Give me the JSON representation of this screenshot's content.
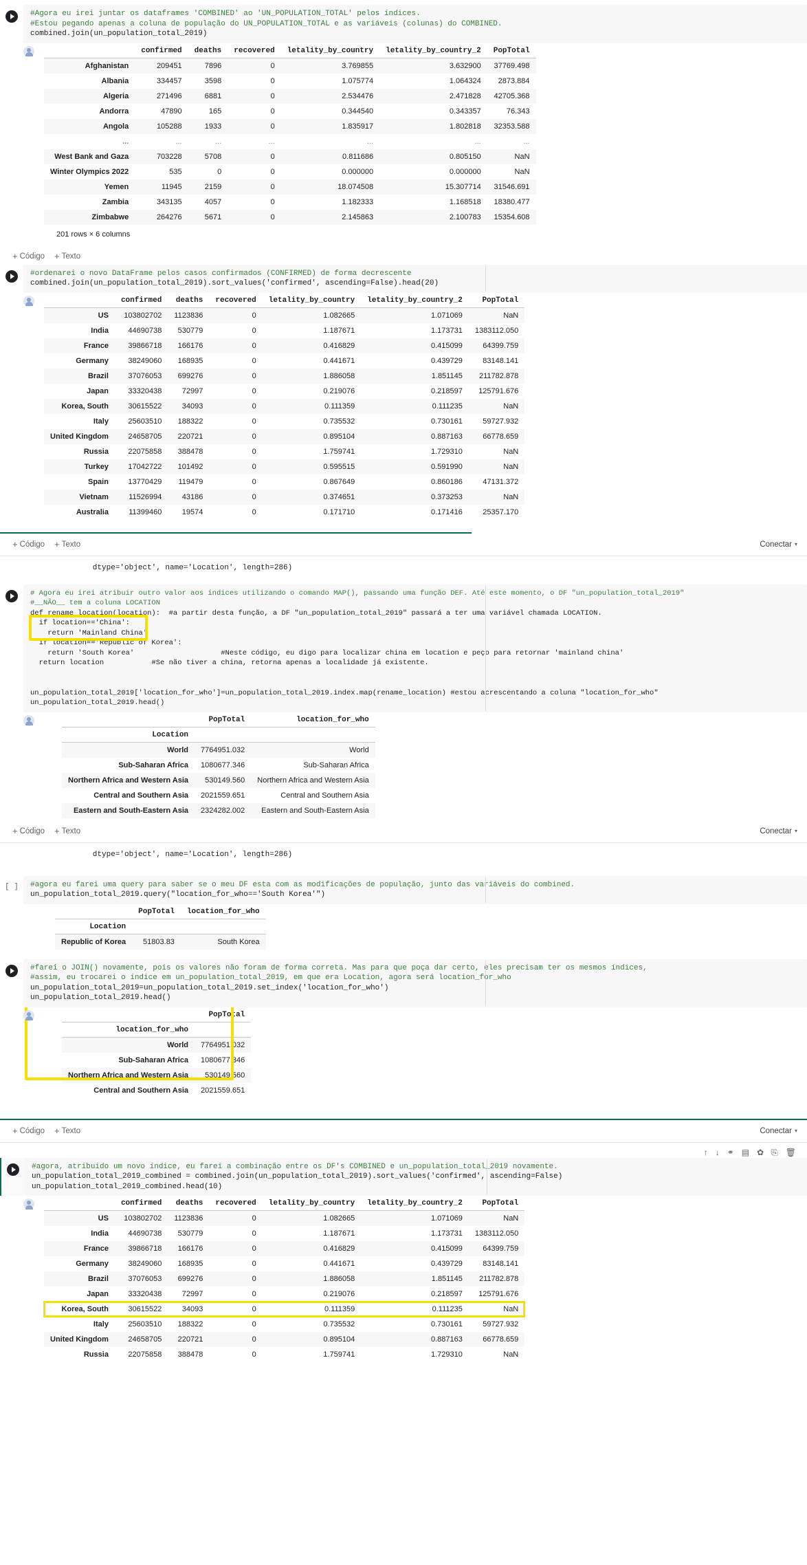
{
  "app": {
    "name": "Google Colab Notebook",
    "toolbar": {
      "add_code": "Código",
      "add_text": "Texto",
      "plus": "+",
      "connect": "Conectar",
      "chevron": "▾"
    },
    "cell_actions": {
      "move_up": "↑",
      "move_down": "↓",
      "link": "⚭",
      "comment": "▤",
      "settings": "✿",
      "mirror": "⎘",
      "delete": "🗑"
    }
  },
  "cells": [
    {
      "id": "cell-join-combined",
      "code_lines": [
        {
          "type": "comment",
          "text": "#Agora eu irei juntar os dataframes 'COMBINED' ao 'UN_POPULATION_TOTAL' pelos índices."
        },
        {
          "type": "comment",
          "text": "#Estou pegando apenas a coluna de população do UN_POPULATION_TOTAL e as variáveis (colunas) do COMBINED."
        },
        {
          "type": "code",
          "text": "combined.join(un_population_total_2019)"
        }
      ],
      "output": {
        "type": "dataframe",
        "index_name": "",
        "columns": [
          "confirmed",
          "deaths",
          "recovered",
          "letality_by_country",
          "letality_by_country_2",
          "PopTotal"
        ],
        "rows": [
          {
            "index": "Afghanistan",
            "values": [
              "209451",
              "7896",
              "0",
              "3.769855",
              "3.632900",
              "37769.498"
            ]
          },
          {
            "index": "Albania",
            "values": [
              "334457",
              "3598",
              "0",
              "1.075774",
              "1.064324",
              "2873.884"
            ]
          },
          {
            "index": "Algeria",
            "values": [
              "271496",
              "6881",
              "0",
              "2.534476",
              "2.471828",
              "42705.368"
            ]
          },
          {
            "index": "Andorra",
            "values": [
              "47890",
              "165",
              "0",
              "0.344540",
              "0.343357",
              "76.343"
            ]
          },
          {
            "index": "Angola",
            "values": [
              "105288",
              "1933",
              "0",
              "1.835917",
              "1.802818",
              "32353.588"
            ]
          },
          {
            "index": "...",
            "values": [
              "...",
              "...",
              "...",
              "...",
              "...",
              "..."
            ],
            "ellipsis": true
          },
          {
            "index": "West Bank and Gaza",
            "values": [
              "703228",
              "5708",
              "0",
              "0.811686",
              "0.805150",
              "NaN"
            ]
          },
          {
            "index": "Winter Olympics 2022",
            "values": [
              "535",
              "0",
              "0",
              "0.000000",
              "0.000000",
              "NaN"
            ]
          },
          {
            "index": "Yemen",
            "values": [
              "11945",
              "2159",
              "0",
              "18.074508",
              "15.307714",
              "31546.691"
            ]
          },
          {
            "index": "Zambia",
            "values": [
              "343135",
              "4057",
              "0",
              "1.182333",
              "1.168518",
              "18380.477"
            ]
          },
          {
            "index": "Zimbabwe",
            "values": [
              "264276",
              "5671",
              "0",
              "2.145863",
              "2.100783",
              "15354.608"
            ]
          }
        ],
        "shape": "201 rows × 6 columns"
      }
    },
    {
      "id": "cell-sort-confirmed",
      "code_lines": [
        {
          "type": "comment",
          "text": "#ordenarei o novo DataFrame pelos casos confirmados (CONFIRMED) de forma decrescente"
        },
        {
          "type": "code",
          "text": "combined.join(un_population_total_2019).sort_values('confirmed', ascending=False).head(20)"
        }
      ],
      "output": {
        "type": "dataframe",
        "columns": [
          "confirmed",
          "deaths",
          "recovered",
          "letality_by_country",
          "letality_by_country_2",
          "PopTotal"
        ],
        "rows": [
          {
            "index": "US",
            "values": [
              "103802702",
              "1123836",
              "0",
              "1.082665",
              "1.071069",
              "NaN"
            ]
          },
          {
            "index": "India",
            "values": [
              "44690738",
              "530779",
              "0",
              "1.187671",
              "1.173731",
              "1383112.050"
            ]
          },
          {
            "index": "France",
            "values": [
              "39866718",
              "166176",
              "0",
              "0.416829",
              "0.415099",
              "64399.759"
            ]
          },
          {
            "index": "Germany",
            "values": [
              "38249060",
              "168935",
              "0",
              "0.441671",
              "0.439729",
              "83148.141"
            ]
          },
          {
            "index": "Brazil",
            "values": [
              "37076053",
              "699276",
              "0",
              "1.886058",
              "1.851145",
              "211782.878"
            ]
          },
          {
            "index": "Japan",
            "values": [
              "33320438",
              "72997",
              "0",
              "0.219076",
              "0.218597",
              "125791.676"
            ]
          },
          {
            "index": "Korea, South",
            "values": [
              "30615522",
              "34093",
              "0",
              "0.111359",
              "0.111235",
              "NaN"
            ]
          },
          {
            "index": "Italy",
            "values": [
              "25603510",
              "188322",
              "0",
              "0.735532",
              "0.730161",
              "59727.932"
            ]
          },
          {
            "index": "United Kingdom",
            "values": [
              "24658705",
              "220721",
              "0",
              "0.895104",
              "0.887163",
              "66778.659"
            ]
          },
          {
            "index": "Russia",
            "values": [
              "22075858",
              "388478",
              "0",
              "1.759741",
              "1.729310",
              "NaN"
            ]
          },
          {
            "index": "Turkey",
            "values": [
              "17042722",
              "101492",
              "0",
              "0.595515",
              "0.591990",
              "NaN"
            ]
          },
          {
            "index": "Spain",
            "values": [
              "13770429",
              "119479",
              "0",
              "0.867649",
              "0.860186",
              "47131.372"
            ]
          },
          {
            "index": "Vietnam",
            "values": [
              "11526994",
              "43186",
              "0",
              "0.374651",
              "0.373253",
              "NaN"
            ]
          },
          {
            "index": "Australia",
            "values": [
              "11399460",
              "19574",
              "0",
              "0.171710",
              "0.171416",
              "25357.170"
            ]
          }
        ]
      }
    },
    {
      "id": "cell-rename-location",
      "pre_output": "        dtype='object', name='Location', length=286)",
      "code_lines": [
        {
          "type": "comment",
          "text": "# Agora eu irei atribuir outro valor aos índices utilizando o comando MAP(), passando uma função DEF. Até este momento, o DF \"un_population_total_2019\""
        },
        {
          "type": "comment",
          "text": "#__NÃO__ tem a coluna LOCATION"
        },
        {
          "type": "code",
          "text": "def rename_location(location):  #a partir desta função, a DF \"un_population_total_2019\" passará a ter uma variável chamada LOCATION."
        },
        {
          "type": "code",
          "text": "  if location=='China':"
        },
        {
          "type": "code",
          "text": "    return 'Mainland China'"
        },
        {
          "type": "code",
          "text": "  if location=='Republic of Korea':"
        },
        {
          "type": "code",
          "text": "    return 'South Korea'                    #Neste código, eu digo para localizar china em location e peço para retornar 'mainland china'"
        },
        {
          "type": "code",
          "text": "  return location           #Se não tiver a china, retorna apenas a localidade já existente."
        },
        {
          "type": "code",
          "text": ""
        },
        {
          "type": "code",
          "text": ""
        },
        {
          "type": "code",
          "text": "un_population_total_2019['location_for_who']=un_population_total_2019.index.map(rename_location) #estou acrescentando a coluna \"location_for_who\""
        },
        {
          "type": "code",
          "text": "un_population_total_2019.head()"
        }
      ],
      "output": {
        "type": "dataframe",
        "index_name": "Location",
        "columns": [
          "PopTotal",
          "location_for_who"
        ],
        "rows": [
          {
            "index": "World",
            "values": [
              "7764951.032",
              "World"
            ]
          },
          {
            "index": "Sub-Saharan Africa",
            "values": [
              "1080677.346",
              "Sub-Saharan Africa"
            ]
          },
          {
            "index": "Northern Africa and Western Asia",
            "values": [
              "530149.560",
              "Northern Africa and Western Asia"
            ]
          },
          {
            "index": "Central and Southern Asia",
            "values": [
              "2021559.651",
              "Central and Southern Asia"
            ]
          },
          {
            "index": "Eastern and South-Eastern Asia",
            "values": [
              "2324282.002",
              "Eastern and South-Eastern Asia"
            ]
          }
        ]
      }
    },
    {
      "id": "cell-query-korea",
      "pre_output": "        dtype='object', name='Location', length=286)",
      "prompt": "[ ]",
      "code_lines": [
        {
          "type": "comment",
          "text": "#agora eu farei uma query para saber se o meu DF esta com as modificações de população, junto das variáveis do combined."
        },
        {
          "type": "code",
          "text": "un_population_total_2019.query(\"location_for_who=='South Korea'\")"
        }
      ],
      "output": {
        "type": "dataframe",
        "index_name": "Location",
        "columns": [
          "PopTotal",
          "location_for_who"
        ],
        "rows": [
          {
            "index": "Republic of Korea",
            "values": [
              "51803.83",
              "South Korea"
            ]
          }
        ]
      }
    },
    {
      "id": "cell-setindex",
      "code_lines": [
        {
          "type": "comment",
          "text": "#farei o JOIN() novamente, pois os valores não foram de forma correta. Mas para que poça dar certo, eles precisam ter os mesmos índices,"
        },
        {
          "type": "comment",
          "text": "#assim, eu trocarei o índice em un_population_total_2019, em que era Location, agora será location_for_who"
        },
        {
          "type": "code",
          "text": "un_population_total_2019=un_population_total_2019.set_index('location_for_who')"
        },
        {
          "type": "code",
          "text": "un_population_total_2019.head()"
        }
      ],
      "output": {
        "type": "dataframe",
        "index_name": "location_for_who",
        "columns": [
          "PopTotal"
        ],
        "rows": [
          {
            "index": "World",
            "values": [
              "7764951.032"
            ]
          },
          {
            "index": "Sub-Saharan Africa",
            "values": [
              "1080677.346"
            ]
          },
          {
            "index": "Northern Africa and Western Asia",
            "values": [
              "530149.560"
            ]
          },
          {
            "index": "Central and Southern Asia",
            "values": [
              "2021559.651"
            ]
          }
        ]
      }
    },
    {
      "id": "cell-final-combined",
      "selected": true,
      "code_lines": [
        {
          "type": "comment",
          "text": "#agora, atribuido um novo índice, eu farei a combinação entre os DF's COMBINED e un_population_total_2019 novamente."
        },
        {
          "type": "code",
          "text": "un_population_total_2019_combined = combined.join(un_population_total_2019).sort_values('confirmed', ascending=False)"
        },
        {
          "type": "code",
          "text": "un_population_total_2019_combined.head(10)"
        }
      ],
      "output": {
        "type": "dataframe",
        "columns": [
          "confirmed",
          "deaths",
          "recovered",
          "letality_by_country",
          "letality_by_country_2",
          "PopTotal"
        ],
        "rows": [
          {
            "index": "US",
            "values": [
              "103802702",
              "1123836",
              "0",
              "1.082665",
              "1.071069",
              "NaN"
            ]
          },
          {
            "index": "India",
            "values": [
              "44690738",
              "530779",
              "0",
              "1.187671",
              "1.173731",
              "1383112.050"
            ]
          },
          {
            "index": "France",
            "values": [
              "39866718",
              "166176",
              "0",
              "0.416829",
              "0.415099",
              "64399.759"
            ]
          },
          {
            "index": "Germany",
            "values": [
              "38249060",
              "168935",
              "0",
              "0.441671",
              "0.439729",
              "83148.141"
            ]
          },
          {
            "index": "Brazil",
            "values": [
              "37076053",
              "699276",
              "0",
              "1.886058",
              "1.851145",
              "211782.878"
            ]
          },
          {
            "index": "Japan",
            "values": [
              "33320438",
              "72997",
              "0",
              "0.219076",
              "0.218597",
              "125791.676"
            ]
          },
          {
            "index": "Korea, South",
            "values": [
              "30615522",
              "34093",
              "0",
              "0.111359",
              "0.111235",
              "NaN"
            ],
            "highlight": true
          },
          {
            "index": "Italy",
            "values": [
              "25603510",
              "188322",
              "0",
              "0.735532",
              "0.730161",
              "59727.932"
            ]
          },
          {
            "index": "United Kingdom",
            "values": [
              "24658705",
              "220721",
              "0",
              "0.895104",
              "0.887163",
              "66778.659"
            ]
          },
          {
            "index": "Russia",
            "values": [
              "22075858",
              "388478",
              "0",
              "1.759741",
              "1.729310",
              "NaN"
            ]
          }
        ]
      }
    }
  ],
  "colors": {
    "highlight": "#f5e000",
    "accent": "#0b6b54",
    "comment": "#3d7d40",
    "string": "#c0392b",
    "keyword": "#a033a0",
    "boolean": "#3b44d8"
  }
}
